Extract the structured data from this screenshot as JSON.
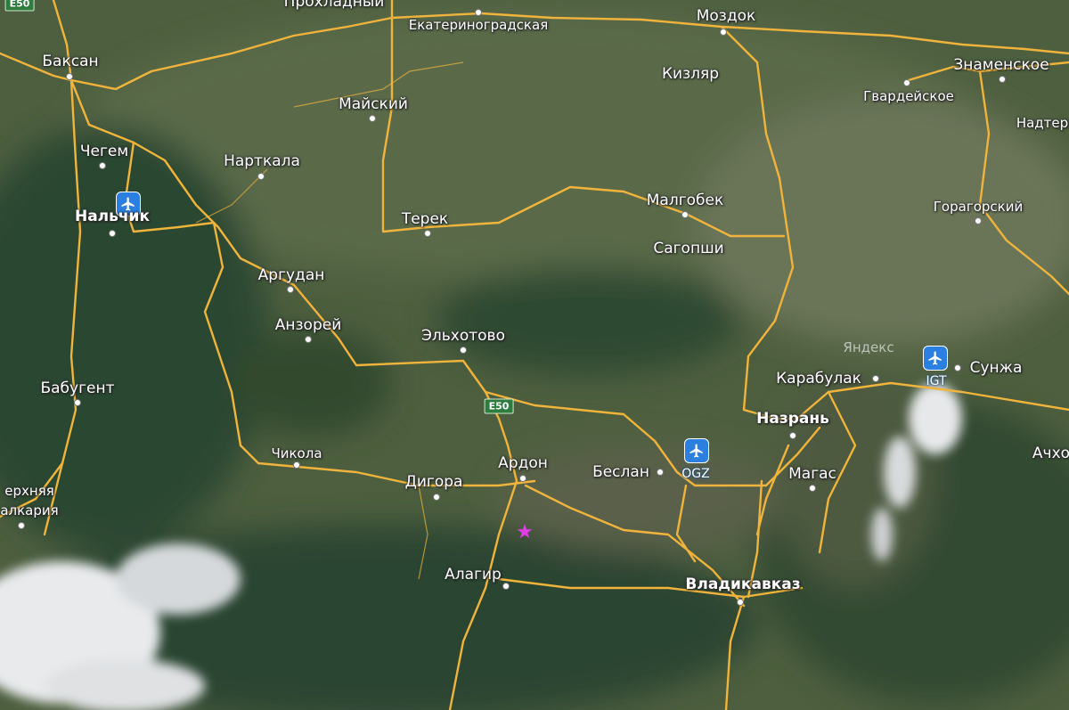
{
  "map": {
    "watermark": "Яндекс",
    "colors": {
      "road": "#f0b43c",
      "terrain_dark": "#2c4630",
      "terrain_mid": "#4a5e3e",
      "snow": "#eef0f2",
      "airport": "#2b7fe0",
      "marker": "#e23be8"
    },
    "road_shields": {
      "top_left": "E50",
      "center": "E50"
    },
    "airports": [
      {
        "code": "",
        "name": "Nalchik airport",
        "icon": "airplane-icon"
      },
      {
        "code": "OGZ",
        "icon": "airplane-icon"
      },
      {
        "code": "IGT",
        "icon": "airplane-icon"
      }
    ],
    "marker": {
      "icon": "star-marker-icon"
    },
    "places": {
      "prokhladny": "Прохладный",
      "ekaterinogradskaya": "Екатериноградская",
      "mozdok": "Моздок",
      "baksan": "Баксан",
      "kizlyar": "Кизляр",
      "znamenskoe": "Знаменское",
      "gvardeyskoe": "Гвардейское",
      "nadterechnaya": "Надтер",
      "maysky": "Майский",
      "chegem": "Чегем",
      "nartkala": "Нарткала",
      "malgobek": "Малгобек",
      "goragorsky": "Горагорский",
      "nalchik": "Нальчик",
      "terek": "Терек",
      "sagopshi": "Сагопши",
      "argudan": "Аргудан",
      "anzorey": "Анзорей",
      "elkhotovo": "Эльхотово",
      "karabulak": "Карабулак",
      "sunzha": "Сунжа",
      "babugent": "Бабугент",
      "nazran": "Назрань",
      "achkhoy": "Ачхо",
      "chikola": "Чикола",
      "ardon": "Ардон",
      "beslan": "Беслан",
      "magas": "Магас",
      "digora": "Дигора",
      "verkhnyaya": "ерхняя",
      "balkaria": "алкария",
      "alagir": "Алагир",
      "vladikavkaz": "Владикавказ"
    }
  }
}
